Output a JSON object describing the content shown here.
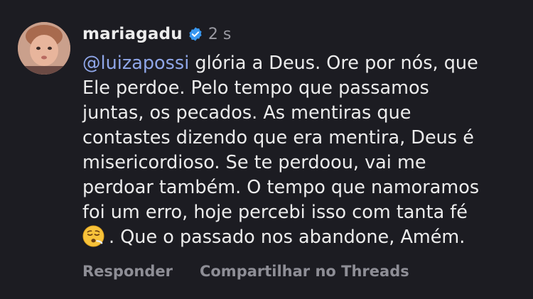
{
  "comment": {
    "username": "mariagadu",
    "verified": true,
    "timestamp": "2 s",
    "mention": "@luizapossi",
    "line1_rest": " glória a Deus.  Ore por nós, que",
    "lines": [
      "Ele perdoe. Pelo tempo que passamos",
      "juntas, os pecados. As mentiras que",
      "contastes dizendo que era mentira, Deus é",
      "misericordioso. Se te perdoou, vai me",
      "perdoar também. O tempo que namoramos",
      "foi um erro, hoje percebi isso com tanta fé"
    ],
    "emoji_icon": "relieved-sigh-face-emoji",
    "last_line": ". Que o passado nos abandone,  Amém."
  },
  "actions": {
    "reply_label": "Responder",
    "share_label": "Compartilhar no Threads"
  },
  "colors": {
    "background": "#1c1c22",
    "text": "#ececec",
    "mention": "#8fa6e8",
    "muted": "#8e8e96",
    "verified_badge": "#3897f0"
  }
}
